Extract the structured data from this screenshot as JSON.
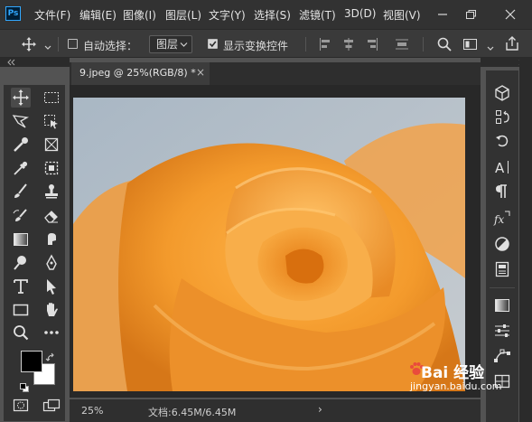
{
  "app": {
    "logo": "Ps"
  },
  "menubar": {
    "items": [
      "文件(F)",
      "编辑(E)",
      "图像(I)",
      "图层(L)",
      "文字(Y)",
      "选择(S)",
      "滤镜(T)",
      "3D(D)",
      "视图(V)"
    ],
    "window_controls": [
      "minimize-icon",
      "restore-icon",
      "close-icon"
    ]
  },
  "options": {
    "auto_select_label": "自动选择：",
    "auto_select_checked": false,
    "target_value": "图层",
    "show_transform_label": "显示变换控件",
    "show_transform_checked": true
  },
  "document": {
    "tab_title": "9.jpeg @ 25%(RGB/8) *",
    "close_glyph": "×"
  },
  "status": {
    "zoom": "25%",
    "doc_info": "文档:6.45M/6.45M",
    "nav_arrow": "›"
  },
  "watermark": {
    "logo_text": "Bai 经验",
    "url": "jingyan.baidu.com"
  },
  "colors": {
    "foreground": "#000000",
    "background": "#ffffff",
    "accent": "#31a8ff"
  }
}
